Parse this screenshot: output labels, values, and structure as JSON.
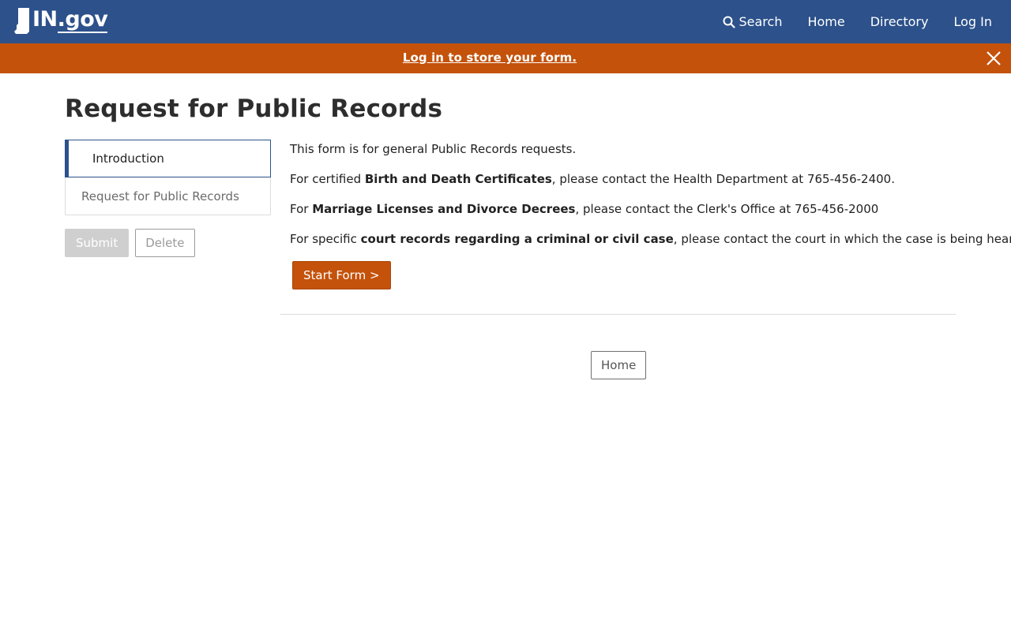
{
  "header": {
    "logo_text_main": "IN",
    "logo_text_suffix": ".gov",
    "nav": {
      "search": "Search",
      "home": "Home",
      "directory": "Directory",
      "login": "Log In"
    },
    "colors": {
      "header_bg": "#2c518b",
      "banner_bg": "#c4520b"
    }
  },
  "banner": {
    "link_text": "Log in to store your form.",
    "close_icon": "close-icon"
  },
  "page": {
    "title": "Request for Public Records"
  },
  "sidebar": {
    "steps": [
      {
        "label": "Introduction",
        "state": "active"
      },
      {
        "label": "Request for Public Records",
        "state": "inactive"
      }
    ],
    "submit_label": "Submit",
    "delete_label": "Delete"
  },
  "content": {
    "intro": "This form is for general Public Records requests.",
    "line2": {
      "pre": "For certified ",
      "bold": "Birth and Death Certificates",
      "post": ", please contact the Health Department at 765-456-2400."
    },
    "line3": {
      "pre": "For ",
      "bold": "Marriage Licenses and Divorce Decrees",
      "post": ", please contact the Clerk's Office at 765-456-2000"
    },
    "line4": {
      "pre": "For specific ",
      "bold": "court records regarding a criminal or civil case",
      "post": ", please contact the court in which the case is being heard."
    },
    "start_button": "Start Form >"
  },
  "footer": {
    "home_button": "Home"
  }
}
